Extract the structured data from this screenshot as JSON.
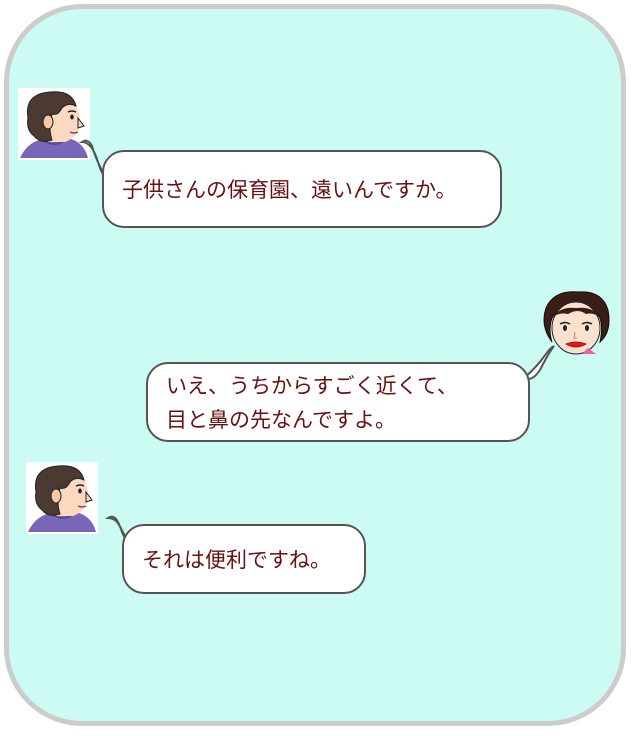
{
  "colors": {
    "background": "#ccfbf4",
    "frame_border": "#cccccc",
    "bubble_fill": "#ffffff",
    "bubble_border": "#555555",
    "text": "#6b1010"
  },
  "messages": [
    {
      "speaker": "woman-dark-hair",
      "side": "left",
      "lines": [
        "子供さんの保育園、遠いんですか。"
      ]
    },
    {
      "speaker": "woman-red-lips",
      "side": "right",
      "lines": [
        "いえ、うちからすごく近くて、",
        "目と鼻の先なんですよ。"
      ]
    },
    {
      "speaker": "woman-dark-hair",
      "side": "left",
      "lines": [
        "それは便利ですね。"
      ]
    }
  ]
}
